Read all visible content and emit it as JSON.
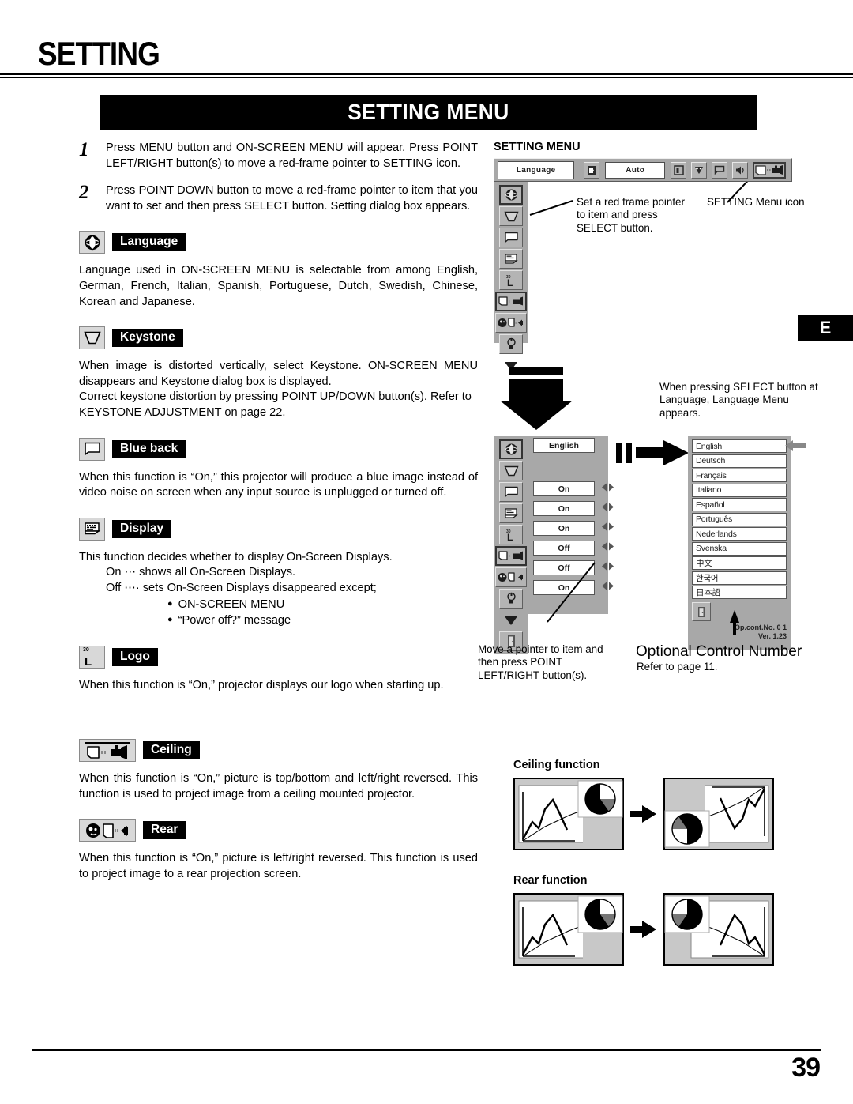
{
  "page": {
    "title": "SETTING",
    "banner": "SETTING MENU",
    "side_tab": "E",
    "number": "39"
  },
  "steps": [
    {
      "num": "1",
      "text": "Press MENU button and ON-SCREEN MENU will appear.  Press POINT LEFT/RIGHT button(s) to move a red-frame pointer to SETTING icon."
    },
    {
      "num": "2",
      "text": "Press POINT DOWN button to move a red-frame pointer to item that you want to set and then press SELECT button.  Setting dialog box appears."
    }
  ],
  "sections": {
    "language": {
      "label": "Language",
      "icon": "globe-icon",
      "text": "Language used in ON-SCREEN MENU is selectable from among English, German, French, Italian, Spanish, Portuguese, Dutch, Swedish, Chinese, Korean and Japanese."
    },
    "keystone": {
      "label": "Keystone",
      "icon": "keystone-trapezoid-icon",
      "text1": "When image is distorted vertically, select Keystone.  ON-SCREEN MENU disappears and Keystone dialog box is displayed.",
      "text2": "Correct keystone distortion by pressing POINT UP/DOWN button(s). Refer to KEYSTONE ADJUSTMENT on page 22."
    },
    "blue_back": {
      "label": "Blue back",
      "icon": "blue-back-screen-icon",
      "text": "When this function is “On,” this projector will produce a blue image instead of video noise on screen when any input source is unplugged or turned off."
    },
    "display": {
      "label": "Display",
      "icon": "display-osd-icon",
      "text": "This function decides whether to display On-Screen Displays.",
      "on_line": "On  ⋯ shows all On-Screen Displays.",
      "off_line": "Off ⋯· sets On-Screen Displays disappeared except;",
      "bullets": [
        "ON-SCREEN MENU",
        "“Power off?” message"
      ]
    },
    "logo": {
      "label": "Logo",
      "icon": "logo-l-icon",
      "icon_badge": "30",
      "icon_letter": "L",
      "text": "When this function is “On,” projector displays our logo when starting up."
    },
    "ceiling": {
      "label": "Ceiling",
      "icon": "ceiling-projector-icon",
      "text": "When this function is “On,” picture is top/bottom and left/right reversed. This function is used to project image from a ceiling mounted projector."
    },
    "rear": {
      "label": "Rear",
      "icon": "rear-projection-icon",
      "text": "When this function is “On,” picture is left/right reversed.  This function is used to project image to a rear projection screen."
    }
  },
  "right": {
    "osd_title": "SETTING MENU",
    "menu_bar": {
      "title_box": "Language",
      "auto_box": "Auto",
      "icons": [
        "input-source-icon",
        "image-adjust-icon",
        "color-adjust-icon",
        "screen-size-icon",
        "sound-icon",
        "setting-menu-icon"
      ],
      "selected_icon": "setting-menu-icon"
    },
    "callout_red_frame": "Set a red frame pointer to item and press SELECT button.",
    "callout_menu_icon": "SETTING Menu icon",
    "callout_select": "When pressing SELECT button at Language, Language Menu appears.",
    "callout_pointer": "Move a pointer to item and then press POINT LEFT/RIGHT button(s).",
    "optional_control_title": "Optional Control Number",
    "optional_control_sub": "Refer to page 11.",
    "dialog_rows": [
      {
        "icon": "globe-icon",
        "value": "English",
        "arrows": false
      },
      {
        "icon": "keystone-trapezoid-icon",
        "value": "",
        "arrows": false
      },
      {
        "icon": "blue-back-screen-icon",
        "value": "On",
        "arrows": true
      },
      {
        "icon": "display-osd-icon",
        "value": "On",
        "arrows": true
      },
      {
        "icon": "logo-l-icon",
        "value": "On",
        "arrows": true
      },
      {
        "icon": "ceiling-projector-icon",
        "value": "Off",
        "arrows": true
      },
      {
        "icon": "rear-projection-icon",
        "value": "Off",
        "arrows": true
      },
      {
        "icon": "lamp-icon",
        "value": "On",
        "arrows": true
      },
      {
        "icon": "scroll-down-icon",
        "value": "",
        "arrows": false
      },
      {
        "icon": "exit-door-icon",
        "value": "",
        "arrows": false
      }
    ],
    "languages": [
      "English",
      "Deutsch",
      "Français",
      "Italiano",
      "Español",
      "Português",
      "Nederlands",
      "Svenska",
      "中文",
      "한국어",
      "日本語"
    ],
    "status_line1": "Op.cont.No. 0 1",
    "status_line2": "Ver.  1.23",
    "ceiling_fig_title": "Ceiling function",
    "rear_fig_title": "Rear function"
  }
}
